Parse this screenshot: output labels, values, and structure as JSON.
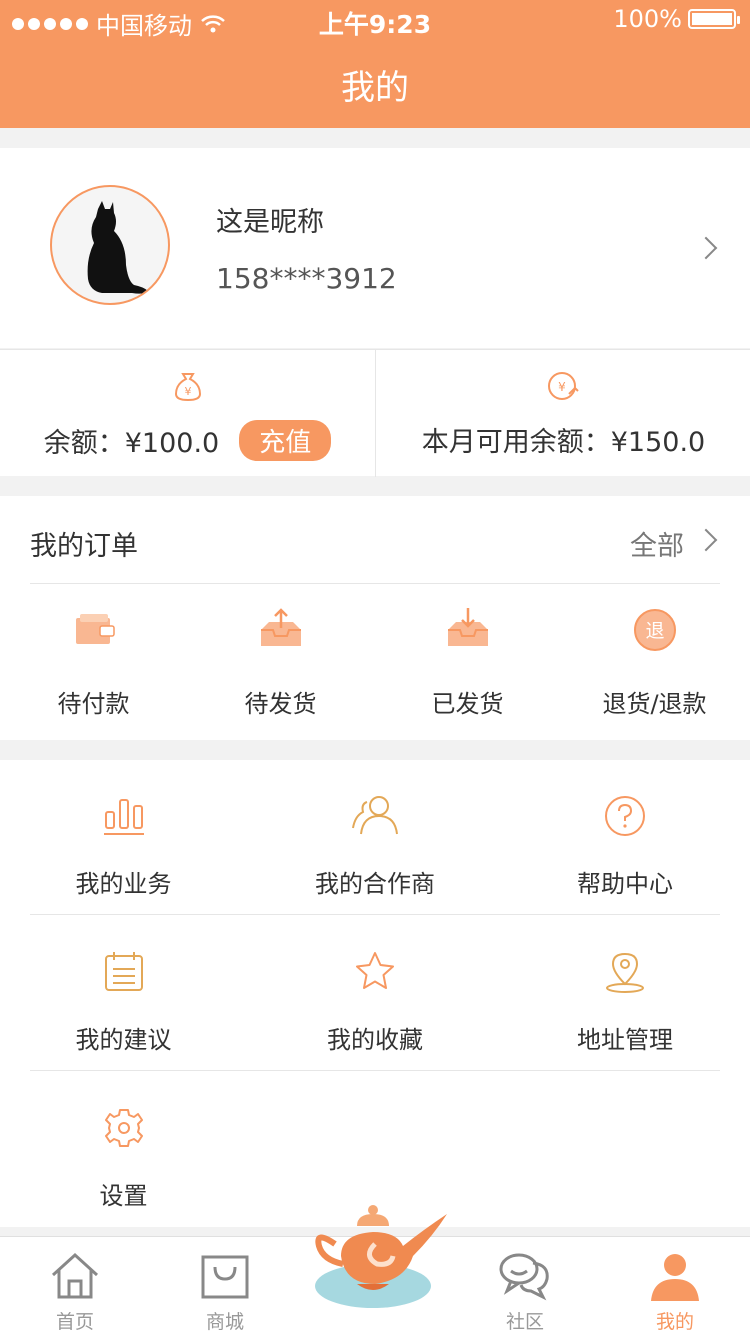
{
  "status_bar": {
    "carrier": "中国移动",
    "time": "上午9:23",
    "battery": "100%"
  },
  "header": {
    "title": "我的"
  },
  "profile": {
    "nickname": "这是昵称",
    "phone": "158****3912"
  },
  "balance": {
    "label": "余额：¥100.0",
    "recharge_label": "充值",
    "monthly_label": "本月可用余额：¥150.0"
  },
  "orders": {
    "title": "我的订单",
    "all_label": "全部",
    "items": [
      {
        "label": "待付款",
        "icon": "wallet-icon"
      },
      {
        "label": "待发货",
        "icon": "box-upload-icon"
      },
      {
        "label": "已发货",
        "icon": "box-download-icon"
      },
      {
        "label": "退货/退款",
        "icon": "refund-icon"
      }
    ],
    "refund_glyph": "退"
  },
  "menu": {
    "items": [
      {
        "label": "我的业务",
        "icon": "bar-chart-icon"
      },
      {
        "label": "我的合作商",
        "icon": "partners-icon"
      },
      {
        "label": "帮助中心",
        "icon": "help-icon"
      },
      {
        "label": "我的建议",
        "icon": "notepad-icon"
      },
      {
        "label": "我的收藏",
        "icon": "star-icon"
      },
      {
        "label": "地址管理",
        "icon": "location-pin-icon"
      },
      {
        "label": "设置",
        "icon": "gear-icon"
      }
    ]
  },
  "tabbar": {
    "items": [
      {
        "label": "首页",
        "icon": "home-icon"
      },
      {
        "label": "商城",
        "icon": "shopping-bag-icon"
      },
      {
        "label": "",
        "icon": "magic-lamp-icon"
      },
      {
        "label": "社区",
        "icon": "chat-bubbles-icon"
      },
      {
        "label": "我的",
        "icon": "user-icon",
        "active": true
      }
    ]
  },
  "colors": {
    "accent": "#f79861",
    "accent_dark": "#e8884f",
    "gold": "#e3a857",
    "lamp_base": "#a6d8e0"
  }
}
